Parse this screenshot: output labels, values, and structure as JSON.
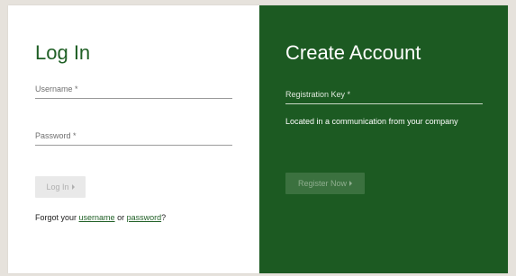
{
  "login": {
    "title": "Log In",
    "username_label": "Username *",
    "password_label": "Password *",
    "button_label": "Log In",
    "forgot": {
      "prefix": "Forgot your ",
      "username_link": "username",
      "middle": " or ",
      "password_link": "password",
      "suffix": "?"
    }
  },
  "create": {
    "title": "Create Account",
    "regkey_label": "Registration Key *",
    "hint": "Located in a communication from your company",
    "button_label": "Register Now"
  },
  "icons": {
    "login_button_caret": "caret-right-icon",
    "register_button_caret": "caret-right-icon"
  },
  "colors": {
    "page_background": "#e6e2dc",
    "brand_green": "#1c5a22",
    "title_green": "#1f5f25",
    "panel_white": "#ffffff"
  }
}
